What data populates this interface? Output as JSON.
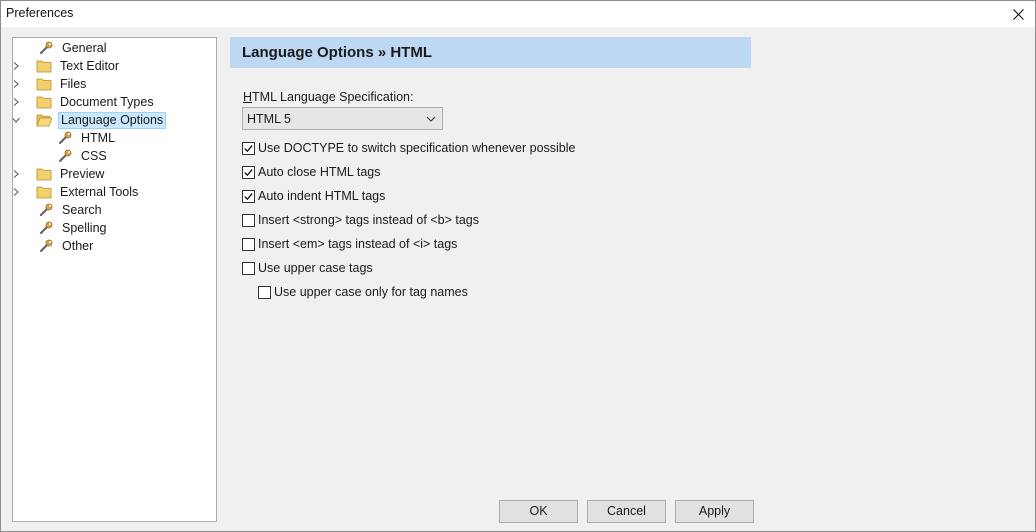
{
  "window": {
    "title": "Preferences"
  },
  "tree": {
    "items": [
      {
        "label": "General",
        "icon": "wrench-icon"
      },
      {
        "label": "Text Editor",
        "icon": "folder-icon"
      },
      {
        "label": "Files",
        "icon": "folder-icon"
      },
      {
        "label": "Document Types",
        "icon": "folder-icon"
      },
      {
        "label": "Language Options",
        "icon": "folder-open-icon"
      },
      {
        "label": "HTML",
        "icon": "wrench-icon"
      },
      {
        "label": "CSS",
        "icon": "wrench-icon"
      },
      {
        "label": "Preview",
        "icon": "folder-icon"
      },
      {
        "label": "External Tools",
        "icon": "folder-icon"
      },
      {
        "label": "Search",
        "icon": "wrench-icon"
      },
      {
        "label": "Spelling",
        "icon": "wrench-icon"
      },
      {
        "label": "Other",
        "icon": "wrench-icon"
      }
    ],
    "selected": "Language Options"
  },
  "panel": {
    "title": "Language Options » HTML",
    "spec_label_first": "H",
    "spec_label_rest": "TML Language Specification:",
    "spec_value": "HTML 5",
    "options": [
      {
        "label": "Use DOCTYPE to switch specification whenever possible",
        "checked": true
      },
      {
        "label": "Auto close HTML tags",
        "checked": true
      },
      {
        "label": "Auto indent HTML tags",
        "checked": true
      },
      {
        "label": "Insert <strong> tags instead of <b> tags",
        "checked": false
      },
      {
        "label": "Insert <em> tags instead of <i> tags",
        "checked": false
      },
      {
        "label": "Use upper case tags",
        "checked": false
      },
      {
        "label": "Use upper case only for tag names",
        "checked": false
      }
    ]
  },
  "buttons": {
    "ok": "OK",
    "cancel": "Cancel",
    "apply": "Apply"
  },
  "colors": {
    "header_bg": "#bcd8f2",
    "selection_bg": "#cce8ff",
    "folder": "#e8c25a"
  }
}
